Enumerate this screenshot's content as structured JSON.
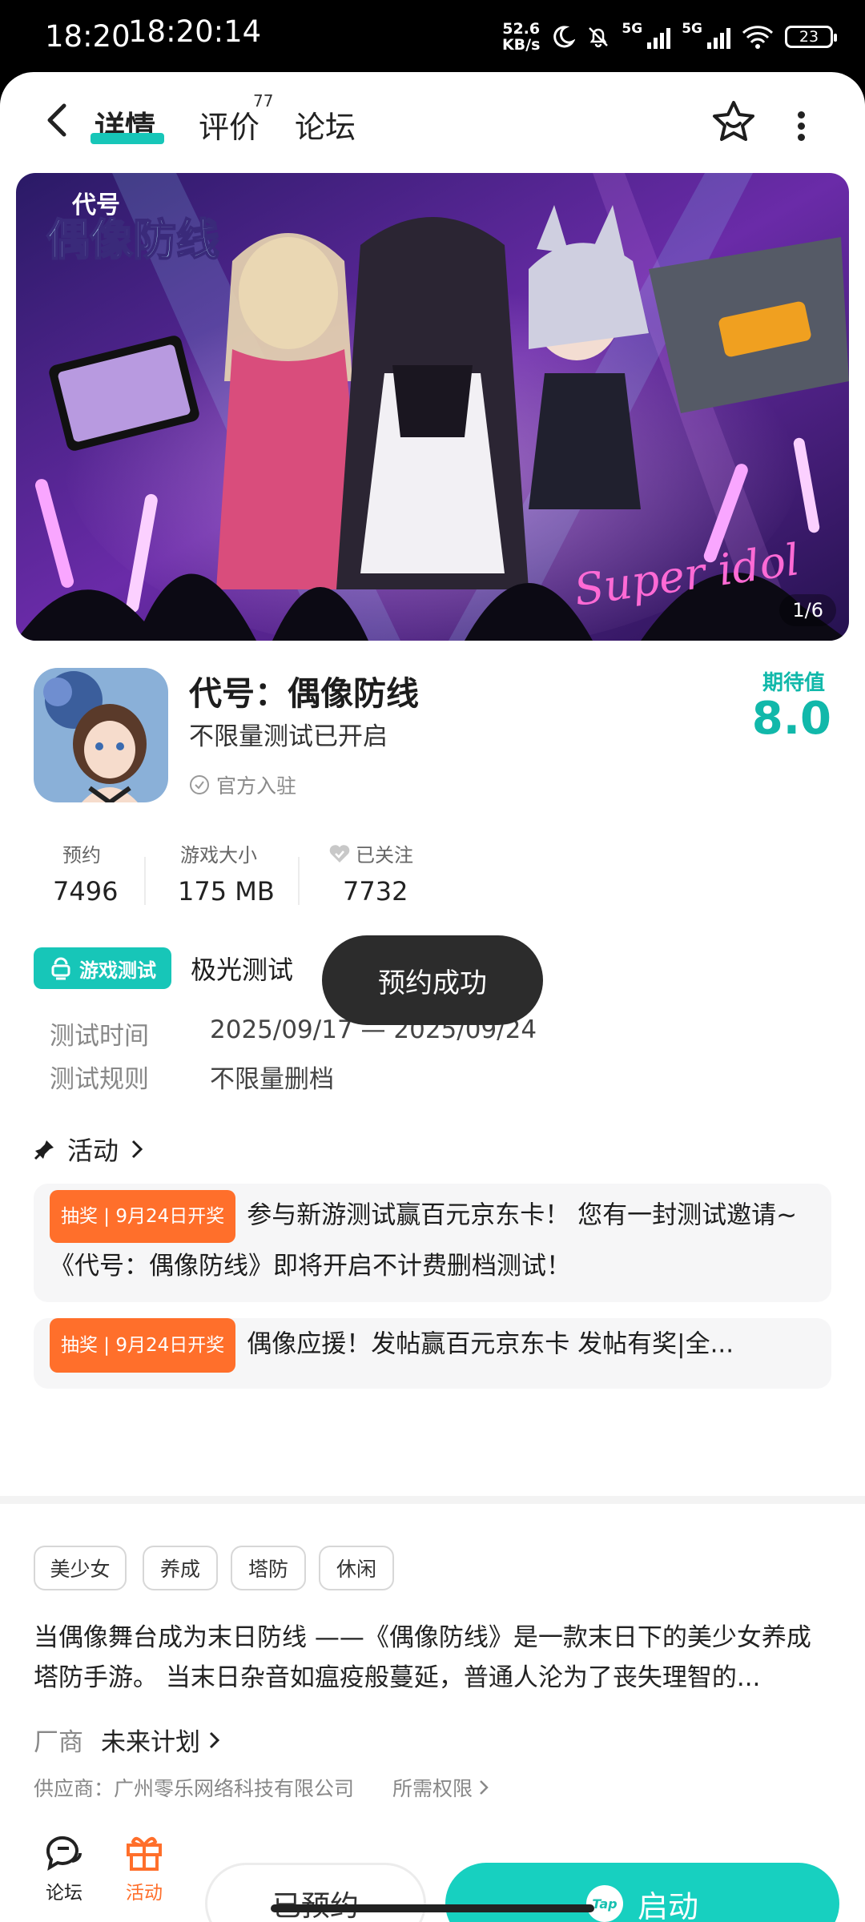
{
  "status_bar": {
    "time_left": "18:20",
    "time_main": "18:20:14",
    "net_speed_value": "52.6",
    "net_speed_unit": "KB/s",
    "sim1": "5G",
    "sim2": "5G",
    "battery": "23"
  },
  "header": {
    "tabs": [
      {
        "label": "详情"
      },
      {
        "label": "评价"
      },
      {
        "label": "论坛"
      }
    ],
    "review_count": "77"
  },
  "banner": {
    "counter": "1/6",
    "title_small": "代号",
    "title_big": "偶像防线",
    "script_text": "Super idol"
  },
  "game": {
    "name": "代号：偶像防线",
    "subtitle": "不限量测试已开启",
    "official": "官方入驻",
    "expect_label": "期待值",
    "expect_score": "8.0"
  },
  "stats": [
    {
      "label": "预约",
      "value": "7496"
    },
    {
      "label": "游戏大小",
      "value": "175 MB"
    },
    {
      "label": "已关注",
      "value": "7732"
    }
  ],
  "test": {
    "badge": "游戏测试",
    "name": "极光测试",
    "time_label": "测试时间",
    "time_value": "2025/09/17 — 2025/09/24",
    "rule_label": "测试规则",
    "rule_value": "不限量删档"
  },
  "toast": "预约成功",
  "activity": {
    "title": "活动",
    "items": [
      {
        "tag": "抽奖 | 9月24日开奖",
        "text": "参与新游测试赢百元京东卡！ 您有一封测试邀请~《代号：偶像防线》即将开启不计费删档测试！"
      },
      {
        "tag": "抽奖 | 9月24日开奖",
        "text": "偶像应援！发帖赢百元京东卡 发帖有奖|全..."
      }
    ]
  },
  "tags": [
    "美少女",
    "养成",
    "塔防",
    "休闲"
  ],
  "description": "当偶像舞台成为末日防线 ——《偶像防线》是一款末日下的美少女养成塔防手游。 当末日杂音如瘟疫般蔓延，普通人沦为了丧失理智的...",
  "maker": {
    "label": "厂商",
    "value": "未来计划"
  },
  "supplier": "供应商：广州零乐网络科技有限公司",
  "permissions": "所需权限",
  "bottom": {
    "forum_label": "论坛",
    "activity_label": "活动",
    "reserved_label": "已预约",
    "start_label": "启动",
    "tap_logo": "Tap"
  },
  "colors": {
    "accent": "#17c6b8",
    "orange": "#ff6f2b",
    "toast_bg": "#2c2c2c"
  }
}
